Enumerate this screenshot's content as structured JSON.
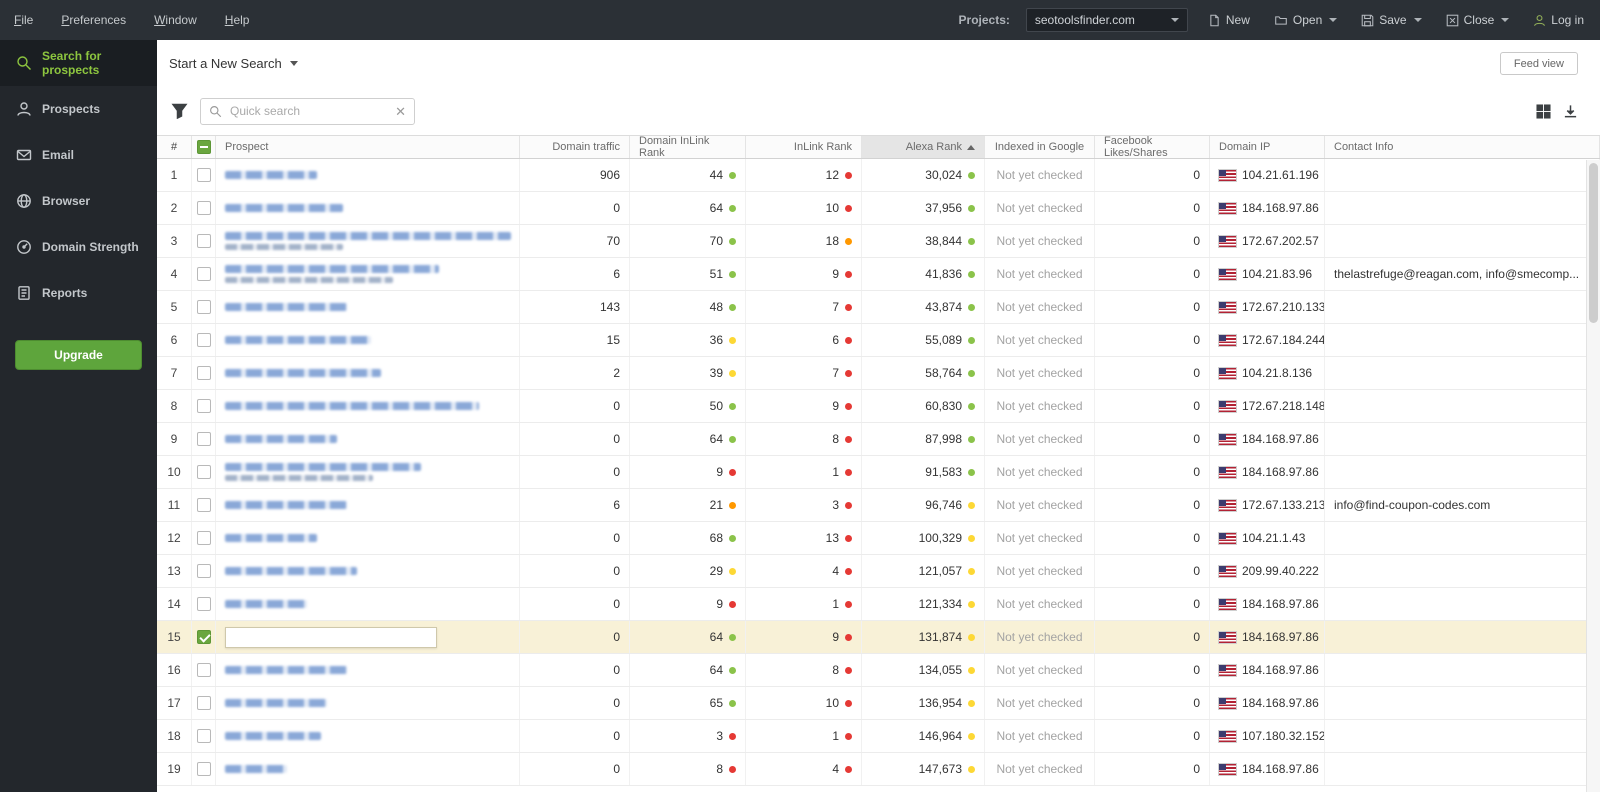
{
  "menubar": {
    "items": [
      "File",
      "Preferences",
      "Window",
      "Help"
    ]
  },
  "topbar": {
    "projects_label": "Projects:",
    "project_value": "seotoolsfinder.com",
    "buttons": [
      {
        "label": "New"
      },
      {
        "label": "Open"
      },
      {
        "label": "Save"
      },
      {
        "label": "Close"
      },
      {
        "label": "Log in"
      }
    ]
  },
  "sidebar": {
    "items": [
      {
        "label": "Search for prospects",
        "icon": "search-icon",
        "active": true
      },
      {
        "label": "Prospects",
        "icon": "person-icon",
        "active": false
      },
      {
        "label": "Email",
        "icon": "email-icon",
        "active": false
      },
      {
        "label": "Browser",
        "icon": "globe-icon",
        "active": false
      },
      {
        "label": "Domain Strength",
        "icon": "gauge-icon",
        "active": false
      },
      {
        "label": "Reports",
        "icon": "report-icon",
        "active": false
      }
    ],
    "upgrade_label": "Upgrade"
  },
  "toolbar": {
    "new_search_label": "Start a New Search",
    "feed_view_label": "Feed view",
    "search_placeholder": "Quick search"
  },
  "colors": {
    "green": "#8bc34a",
    "yellow": "#fdd835",
    "orange": "#ff9800",
    "red": "#e53935",
    "accent_green": "#8dc63f",
    "upgrade_green": "#5ea53c",
    "selected_row": "#f8f1d7"
  },
  "table": {
    "columns": [
      "#",
      "Prospect",
      "Domain traffic",
      "Domain InLink Rank",
      "InLink Rank",
      "Alexa Rank",
      "Indexed in Google",
      "Facebook Likes/Shares",
      "Domain IP",
      "Contact Info"
    ],
    "sort": {
      "column": "Alexa Rank",
      "direction": "asc"
    },
    "rows": [
      {
        "num": "1",
        "pw": 92,
        "pw2": 0,
        "traffic": "906",
        "dir": "44",
        "dir_c": "green",
        "ir": "12",
        "ir_c": "red",
        "alexa": "30,024",
        "alexa_c": "green",
        "indexed": "Not yet checked",
        "fb": "0",
        "ip": "104.21.61.196",
        "contact": "",
        "checked": false,
        "selected": false
      },
      {
        "num": "2",
        "pw": 118,
        "pw2": 0,
        "traffic": "0",
        "dir": "64",
        "dir_c": "green",
        "ir": "10",
        "ir_c": "red",
        "alexa": "37,956",
        "alexa_c": "green",
        "indexed": "Not yet checked",
        "fb": "0",
        "ip": "184.168.97.86",
        "contact": "",
        "checked": false,
        "selected": false
      },
      {
        "num": "3",
        "pw": 286,
        "pw2": 118,
        "traffic": "70",
        "dir": "70",
        "dir_c": "green",
        "ir": "18",
        "ir_c": "orange",
        "alexa": "38,844",
        "alexa_c": "green",
        "indexed": "Not yet checked",
        "fb": "0",
        "ip": "172.67.202.57",
        "contact": "",
        "checked": false,
        "selected": false
      },
      {
        "num": "4",
        "pw": 214,
        "pw2": 168,
        "traffic": "6",
        "dir": "51",
        "dir_c": "green",
        "ir": "9",
        "ir_c": "red",
        "alexa": "41,836",
        "alexa_c": "green",
        "indexed": "Not yet checked",
        "fb": "0",
        "ip": "104.21.83.96",
        "contact": "thelastrefuge@reagan.com, info@smecomp...",
        "checked": false,
        "selected": false
      },
      {
        "num": "5",
        "pw": 122,
        "pw2": 0,
        "traffic": "143",
        "dir": "48",
        "dir_c": "green",
        "ir": "7",
        "ir_c": "red",
        "alexa": "43,874",
        "alexa_c": "green",
        "indexed": "Not yet checked",
        "fb": "0",
        "ip": "172.67.210.133",
        "contact": "",
        "checked": false,
        "selected": false
      },
      {
        "num": "6",
        "pw": 146,
        "pw2": 0,
        "traffic": "15",
        "dir": "36",
        "dir_c": "yellow",
        "ir": "6",
        "ir_c": "red",
        "alexa": "55,089",
        "alexa_c": "green",
        "indexed": "Not yet checked",
        "fb": "0",
        "ip": "172.67.184.244",
        "contact": "",
        "checked": false,
        "selected": false
      },
      {
        "num": "7",
        "pw": 156,
        "pw2": 0,
        "traffic": "2",
        "dir": "39",
        "dir_c": "yellow",
        "ir": "7",
        "ir_c": "red",
        "alexa": "58,764",
        "alexa_c": "green",
        "indexed": "Not yet checked",
        "fb": "0",
        "ip": "104.21.8.136",
        "contact": "",
        "checked": false,
        "selected": false
      },
      {
        "num": "8",
        "pw": 254,
        "pw2": 0,
        "traffic": "0",
        "dir": "50",
        "dir_c": "green",
        "ir": "9",
        "ir_c": "red",
        "alexa": "60,830",
        "alexa_c": "green",
        "indexed": "Not yet checked",
        "fb": "0",
        "ip": "172.67.218.148",
        "contact": "",
        "checked": false,
        "selected": false
      },
      {
        "num": "9",
        "pw": 112,
        "pw2": 0,
        "traffic": "0",
        "dir": "64",
        "dir_c": "green",
        "ir": "8",
        "ir_c": "red",
        "alexa": "87,998",
        "alexa_c": "green",
        "indexed": "Not yet checked",
        "fb": "0",
        "ip": "184.168.97.86",
        "contact": "",
        "checked": false,
        "selected": false
      },
      {
        "num": "10",
        "pw": 196,
        "pw2": 148,
        "traffic": "0",
        "dir": "9",
        "dir_c": "red",
        "ir": "1",
        "ir_c": "red",
        "alexa": "91,583",
        "alexa_c": "green",
        "indexed": "Not yet checked",
        "fb": "0",
        "ip": "184.168.97.86",
        "contact": "",
        "checked": false,
        "selected": false
      },
      {
        "num": "11",
        "pw": 122,
        "pw2": 0,
        "traffic": "6",
        "dir": "21",
        "dir_c": "orange",
        "ir": "3",
        "ir_c": "red",
        "alexa": "96,746",
        "alexa_c": "yellow",
        "indexed": "Not yet checked",
        "fb": "0",
        "ip": "172.67.133.213",
        "contact": "info@find-coupon-codes.com",
        "checked": false,
        "selected": false
      },
      {
        "num": "12",
        "pw": 92,
        "pw2": 0,
        "traffic": "0",
        "dir": "68",
        "dir_c": "green",
        "ir": "13",
        "ir_c": "red",
        "alexa": "100,329",
        "alexa_c": "yellow",
        "indexed": "Not yet checked",
        "fb": "0",
        "ip": "104.21.1.43",
        "contact": "",
        "checked": false,
        "selected": false
      },
      {
        "num": "13",
        "pw": 132,
        "pw2": 0,
        "traffic": "0",
        "dir": "29",
        "dir_c": "yellow",
        "ir": "4",
        "ir_c": "red",
        "alexa": "121,057",
        "alexa_c": "yellow",
        "indexed": "Not yet checked",
        "fb": "0",
        "ip": "209.99.40.222",
        "contact": "",
        "checked": false,
        "selected": false
      },
      {
        "num": "14",
        "pw": 82,
        "pw2": 0,
        "traffic": "0",
        "dir": "9",
        "dir_c": "red",
        "ir": "1",
        "ir_c": "red",
        "alexa": "121,334",
        "alexa_c": "yellow",
        "indexed": "Not yet checked",
        "fb": "0",
        "ip": "184.168.97.86",
        "contact": "",
        "checked": false,
        "selected": false
      },
      {
        "num": "15",
        "pw": 0,
        "pw2": 0,
        "edit_box": true,
        "traffic": "0",
        "dir": "64",
        "dir_c": "green",
        "ir": "9",
        "ir_c": "red",
        "alexa": "131,874",
        "alexa_c": "yellow",
        "indexed": "Not yet checked",
        "fb": "0",
        "ip": "184.168.97.86",
        "contact": "",
        "checked": true,
        "selected": true
      },
      {
        "num": "16",
        "pw": 122,
        "pw2": 0,
        "traffic": "0",
        "dir": "64",
        "dir_c": "green",
        "ir": "8",
        "ir_c": "red",
        "alexa": "134,055",
        "alexa_c": "yellow",
        "indexed": "Not yet checked",
        "fb": "0",
        "ip": "184.168.97.86",
        "contact": "",
        "checked": false,
        "selected": false
      },
      {
        "num": "17",
        "pw": 102,
        "pw2": 0,
        "traffic": "0",
        "dir": "65",
        "dir_c": "green",
        "ir": "10",
        "ir_c": "red",
        "alexa": "136,954",
        "alexa_c": "yellow",
        "indexed": "Not yet checked",
        "fb": "0",
        "ip": "184.168.97.86",
        "contact": "",
        "checked": false,
        "selected": false
      },
      {
        "num": "18",
        "pw": 96,
        "pw2": 0,
        "traffic": "0",
        "dir": "3",
        "dir_c": "red",
        "ir": "1",
        "ir_c": "red",
        "alexa": "146,964",
        "alexa_c": "yellow",
        "indexed": "Not yet checked",
        "fb": "0",
        "ip": "107.180.32.152",
        "contact": "",
        "checked": false,
        "selected": false
      },
      {
        "num": "19",
        "pw": 62,
        "pw2": 0,
        "traffic": "0",
        "dir": "8",
        "dir_c": "red",
        "ir": "4",
        "ir_c": "red",
        "alexa": "147,673",
        "alexa_c": "yellow",
        "indexed": "Not yet checked",
        "fb": "0",
        "ip": "184.168.97.86",
        "contact": "",
        "checked": false,
        "selected": false
      }
    ]
  }
}
